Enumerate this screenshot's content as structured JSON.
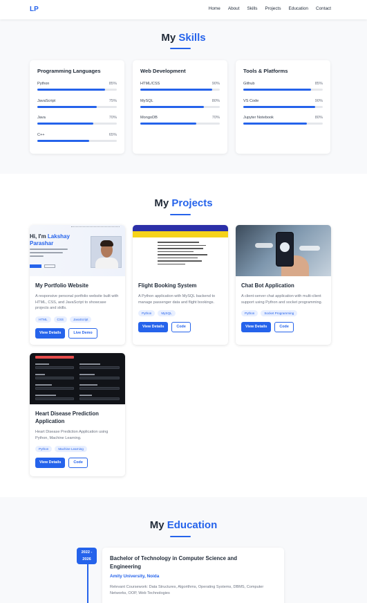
{
  "nav": {
    "logo": "LP",
    "links": [
      "Home",
      "About",
      "Skills",
      "Projects",
      "Education",
      "Contact"
    ]
  },
  "colors": {
    "accent": "#2563eb",
    "section_bg": "#f8f9fb",
    "text": "#1f2937"
  },
  "skills": {
    "title_prefix": "My",
    "title_accent": "Skills",
    "cards": [
      {
        "title": "Programming Languages",
        "items": [
          {
            "name": "Python",
            "percent_label": "85%",
            "level": 85
          },
          {
            "name": "JavaScript",
            "percent_label": "75%",
            "level": 75
          },
          {
            "name": "Java",
            "percent_label": "70%",
            "level": 70
          },
          {
            "name": "C++",
            "percent_label": "65%",
            "level": 65
          }
        ]
      },
      {
        "title": "Web Development",
        "items": [
          {
            "name": "HTML/CSS",
            "percent_label": "90%",
            "level": 90
          },
          {
            "name": "MySQL",
            "percent_label": "80%",
            "level": 80
          },
          {
            "name": "MongoDB",
            "percent_label": "70%",
            "level": 70
          }
        ]
      },
      {
        "title": "Tools & Platforms",
        "items": [
          {
            "name": "Github",
            "percent_label": "85%",
            "level": 85
          },
          {
            "name": "VS Code",
            "percent_label": "90%",
            "level": 90
          },
          {
            "name": "Jupyter Notebook",
            "percent_label": "80%",
            "level": 80
          }
        ]
      }
    ]
  },
  "projects": {
    "title_prefix": "My",
    "title_accent": "Projects",
    "cards": [
      {
        "title": "My Portfolio Website",
        "description": "A responsive personal portfolio website built with HTML, CSS, and JavaScript to showcase projects and skills.",
        "tags": [
          "HTML",
          "CSS",
          "JavaScript"
        ],
        "primary_button": "View Details",
        "secondary_button": "Live Demo",
        "thumb": {
          "greeting": "Hi, I'm",
          "name": "Lakshay Parashar"
        }
      },
      {
        "title": "Flight Booking System",
        "description": "A Python application with MySQL backend to manage passenger data and flight bookings.",
        "tags": [
          "Python",
          "MySQL"
        ],
        "primary_button": "View Details",
        "secondary_button": "Code"
      },
      {
        "title": "Chat Bot Application",
        "description": "A client-server chat application with multi-client support using Python and socket programming.",
        "tags": [
          "Python",
          "Socket Programming"
        ],
        "primary_button": "View Details",
        "secondary_button": "Code"
      },
      {
        "title": "Heart Disease Prediction Application",
        "description": "Heart Disease Prediction Application using Python, Machine Learning.",
        "tags": [
          "Python",
          "Machine Learning"
        ],
        "primary_button": "View Details",
        "secondary_button": "Code"
      }
    ]
  },
  "education": {
    "title_prefix": "My",
    "title_accent": "Education",
    "entries": [
      {
        "years": "2022 - 2026",
        "degree": "Bachelor of Technology in Computer Science and Engineering",
        "school": "Amity University, Noida",
        "coursework": "Relevant Coursework: Data Structures, Algorithms, Operating Systems, DBMS, Computer Networks, OOP, Web Technologies"
      }
    ]
  }
}
